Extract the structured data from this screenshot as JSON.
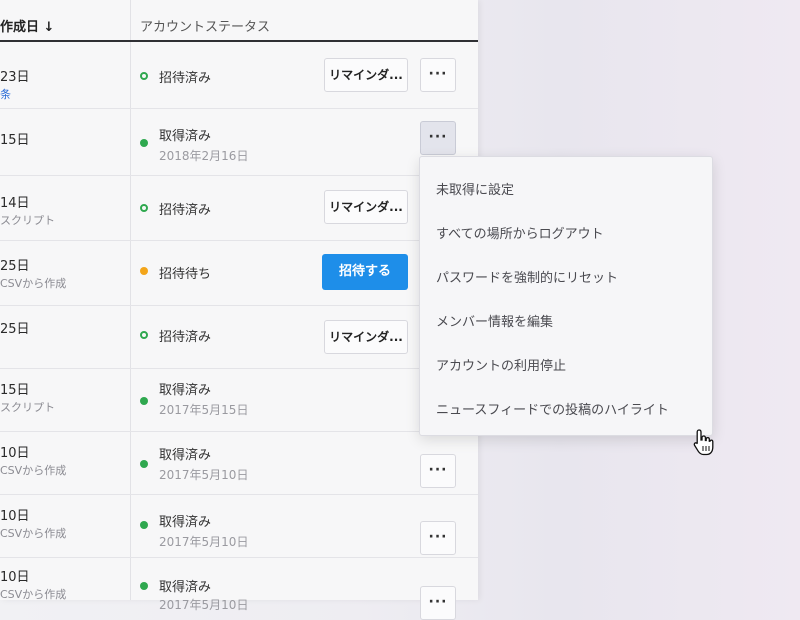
{
  "header": {
    "created_col": "作成日 ↓",
    "status_col": "アカウントステータス"
  },
  "rows": [
    {
      "date": "23日",
      "sub": "条",
      "status": "招待済み",
      "status_date": "",
      "action": "リマインダ...",
      "more": "···"
    },
    {
      "date": "15日",
      "sub": "",
      "status": "取得済み",
      "status_date": "2018年2月16日",
      "action": "",
      "more": "···"
    },
    {
      "date": "14日",
      "sub": "スクリプト",
      "status": "招待済み",
      "status_date": "",
      "action": "リマインダ...",
      "more": ""
    },
    {
      "date": "25日",
      "sub": "CSVから作成",
      "status": "招待待ち",
      "status_date": "",
      "action": "招待する",
      "more": ""
    },
    {
      "date": "25日",
      "sub": "",
      "status": "招待済み",
      "status_date": "",
      "action": "リマインダ...",
      "more": ""
    },
    {
      "date": "15日",
      "sub": "スクリプト",
      "status": "取得済み",
      "status_date": "2017年5月15日",
      "action": "",
      "more": ""
    },
    {
      "date": "10日",
      "sub": "CSVから作成",
      "status": "取得済み",
      "status_date": "2017年5月10日",
      "action": "",
      "more": "···"
    },
    {
      "date": "10日",
      "sub": "CSVから作成",
      "status": "取得済み",
      "status_date": "2017年5月10日",
      "action": "",
      "more": "···"
    },
    {
      "date": "10日",
      "sub": "CSVから作成",
      "status": "取得済み",
      "status_date": "2017年5月10日",
      "action": "",
      "more": "···"
    }
  ],
  "menu": {
    "items": [
      "未取得に設定",
      "すべての場所からログアウト",
      "パスワードを強制的にリセット",
      "メンバー情報を編集",
      "アカウントの利用停止",
      "ニュースフィードでの投稿のハイライト"
    ]
  },
  "colors": {
    "accent": "#1e8ee9",
    "status_claimed": "#2fa84f",
    "status_pending": "#f3a51a"
  }
}
